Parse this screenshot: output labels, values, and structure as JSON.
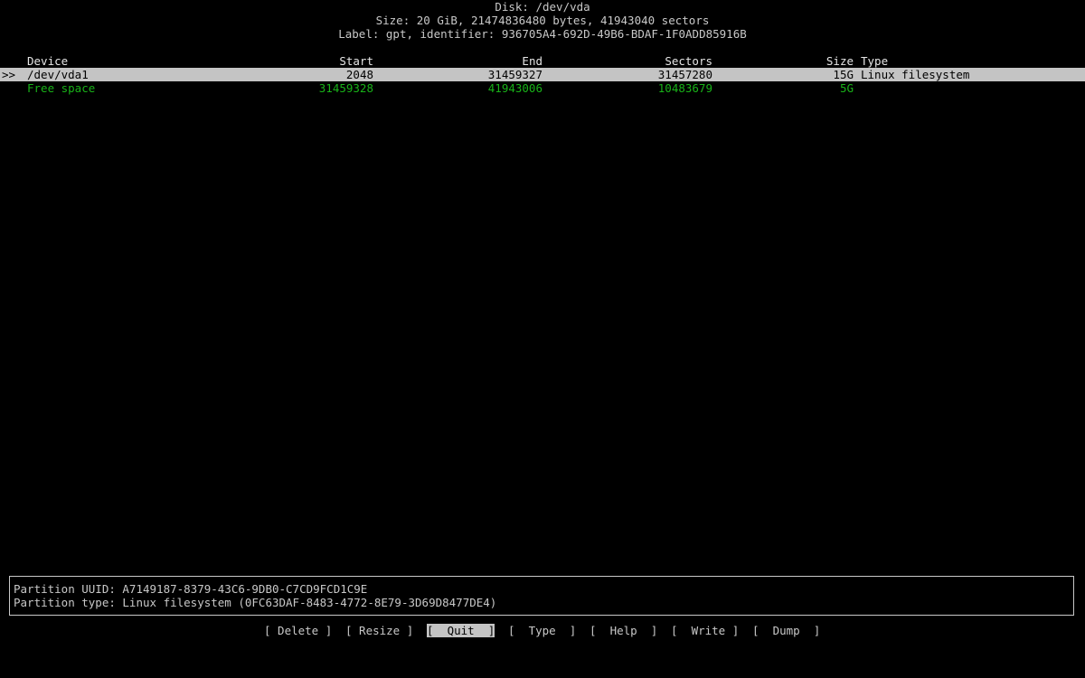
{
  "header": {
    "title": "Disk: /dev/vda",
    "size_line": "Size: 20 GiB, 21474836480 bytes, 41943040 sectors",
    "label_line": "Label: gpt, identifier: 936705A4-692D-49B6-BDAF-1F0ADD85916B"
  },
  "table": {
    "columns": {
      "device": "Device",
      "start": "Start",
      "end": "End",
      "sectors": "Sectors",
      "size": "Size",
      "type": "Type"
    },
    "rows": [
      {
        "marker": ">>",
        "device": "/dev/vda1",
        "start": "2048",
        "end": "31459327",
        "sectors": "31457280",
        "size": "15G",
        "type": "Linux filesystem",
        "selected": true
      },
      {
        "marker": "",
        "device": "Free space",
        "start": "31459328",
        "end": "41943006",
        "sectors": "10483679",
        "size": "5G",
        "type": "",
        "selected": false
      }
    ]
  },
  "info": {
    "uuid_line": "Partition UUID: A7149187-8379-43C6-9DB0-C7CD9FCD1C9E",
    "type_line": "Partition type: Linux filesystem (0FC63DAF-8483-4772-8E79-3D69D8477DE4)"
  },
  "menu": {
    "items": [
      "[ Delete ]",
      "[ Resize ]",
      "[  Quit  ]",
      "[  Type  ]",
      "[  Help  ]",
      "[  Write ]",
      "[  Dump  ]"
    ],
    "active_index": 2
  },
  "colors": {
    "background": "#000000",
    "text": "#c8c8c8",
    "highlight": "#c4c4c4",
    "free_space": "#18b218"
  }
}
